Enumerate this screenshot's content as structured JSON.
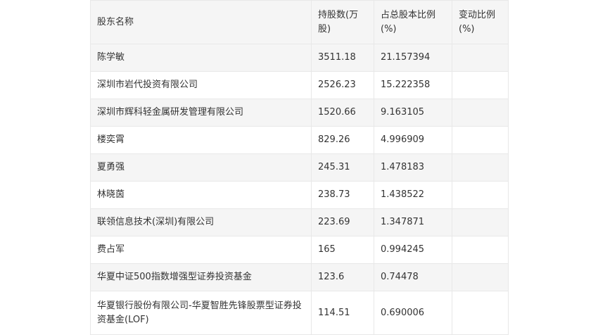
{
  "table": {
    "headers": [
      "股东名称",
      "持股数(万股)",
      "占总股本比例(%)",
      "变动比例(%)"
    ],
    "rows": [
      {
        "name": "陈学敏",
        "shares": "3511.18",
        "ratio": "21.157394",
        "change": ""
      },
      {
        "name": "深圳市岩代投资有限公司",
        "shares": "2526.23",
        "ratio": "15.222358",
        "change": ""
      },
      {
        "name": "深圳市辉科轻金属研发管理有限公司",
        "shares": "1520.66",
        "ratio": "9.163105",
        "change": ""
      },
      {
        "name": "楼奕霄",
        "shares": "829.26",
        "ratio": "4.996909",
        "change": ""
      },
      {
        "name": "夏勇强",
        "shares": "245.31",
        "ratio": "1.478183",
        "change": ""
      },
      {
        "name": "林晓茵",
        "shares": "238.73",
        "ratio": "1.438522",
        "change": ""
      },
      {
        "name": "联领信息技术(深圳)有限公司",
        "shares": "223.69",
        "ratio": "1.347871",
        "change": ""
      },
      {
        "name": "费占军",
        "shares": "165",
        "ratio": "0.994245",
        "change": ""
      },
      {
        "name": "华夏中证500指数增强型证券投资基金",
        "shares": "123.6",
        "ratio": "0.74478",
        "change": ""
      },
      {
        "name": "华夏银行股份有限公司-华夏智胜先锋股票型证券投资基金(LOF)",
        "shares": "114.51",
        "ratio": "0.690006",
        "change": ""
      }
    ]
  }
}
